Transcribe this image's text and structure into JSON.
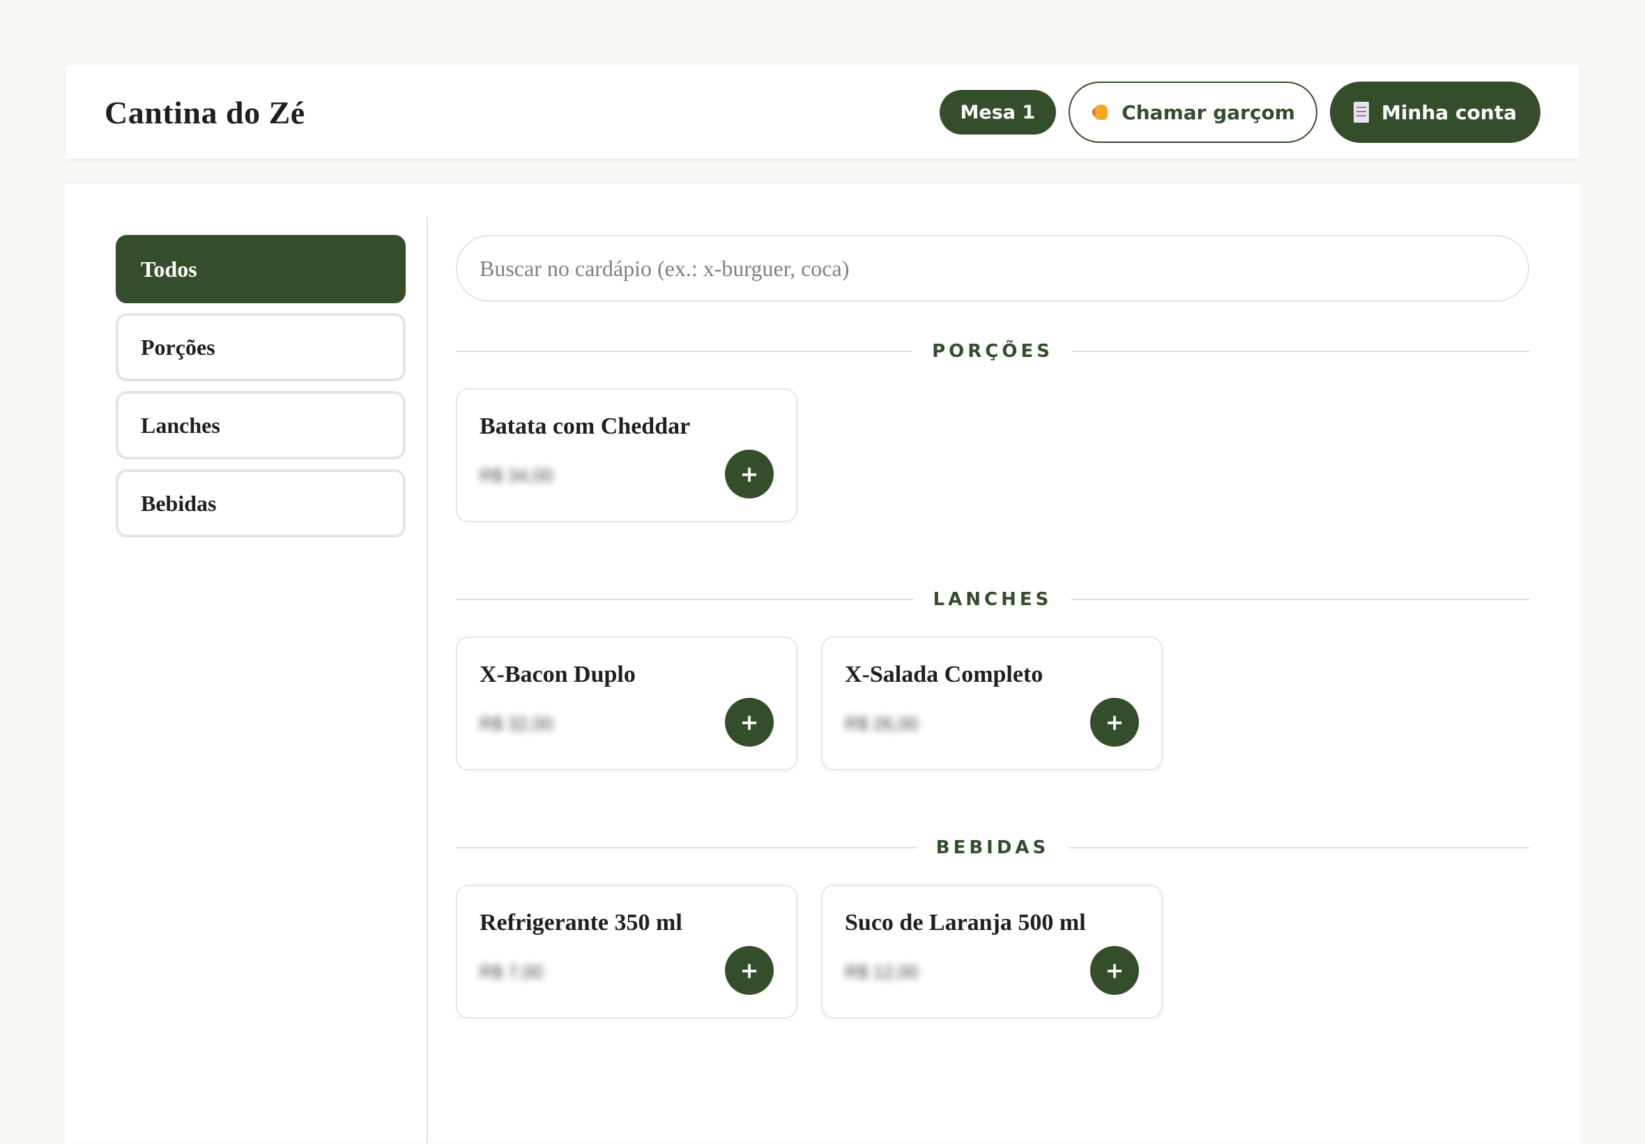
{
  "header": {
    "brand": "Cantina do Zé",
    "table_badge": "Mesa 1",
    "call_waiter_label": "Chamar garçom",
    "my_bill_label": "Minha conta"
  },
  "sidebar": {
    "items": [
      {
        "label": "Todos"
      },
      {
        "label": "Porções"
      },
      {
        "label": "Lanches"
      },
      {
        "label": "Bebidas"
      }
    ]
  },
  "search": {
    "placeholder": "Buscar no cardápio (ex.: x-burguer, coca)",
    "value": ""
  },
  "sections": [
    {
      "title": "PORÇÕES",
      "items": [
        {
          "name": "Batata com Cheddar",
          "price": "R$ 34,00",
          "add_label": "+"
        }
      ]
    },
    {
      "title": "LANCHES",
      "items": [
        {
          "name": "X-Bacon Duplo",
          "price": "R$ 32,00",
          "add_label": "+"
        },
        {
          "name": "X-Salada Completo",
          "price": "R$ 26,00",
          "add_label": "+"
        }
      ]
    },
    {
      "title": "BEBIDAS",
      "items": [
        {
          "name": "Refrigerante 350 ml",
          "price": "R$ 7,00",
          "add_label": "+"
        },
        {
          "name": "Suco de Laranja 500 ml",
          "price": "R$ 12,00",
          "add_label": "+"
        }
      ]
    }
  ],
  "icons": {
    "call_waiter": "waving-hand-icon",
    "my_bill": "receipt-icon"
  },
  "colors": {
    "accent": "#344e2c",
    "background": "#f8f7f3",
    "surface": "#ffffff"
  }
}
